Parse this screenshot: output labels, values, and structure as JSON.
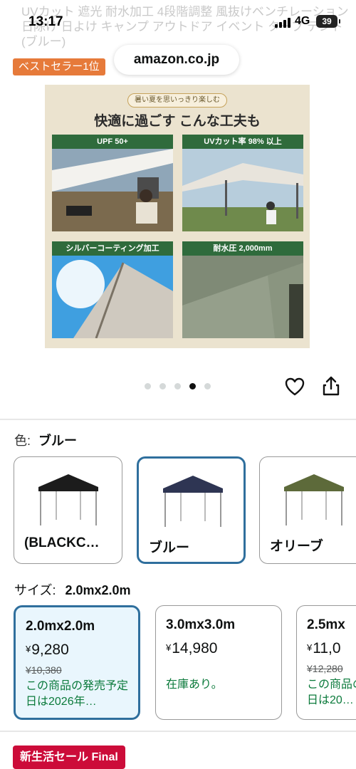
{
  "status_bar": {
    "time": "13:17",
    "network": "4G",
    "battery": "39"
  },
  "browser": {
    "url": "amazon.co.jp"
  },
  "product_title": "UVカット 遮光 耐水加工 4段階調整 風抜けベンチレーション 日除け 日よけ キャンプ アウトドア イベント タープ テント (ブルー)",
  "badge": {
    "bestseller": "ベストセラー1位"
  },
  "hero": {
    "banner": "暑い夏を思いっきり楽しむ",
    "headline": "快適に過ごす こんな工夫も",
    "panels": [
      {
        "label": "UPF 50+"
      },
      {
        "label": "UVカット率 98% 以上"
      },
      {
        "label": "シルバーコーティング加工"
      },
      {
        "label": "耐水圧 2,000mm"
      }
    ]
  },
  "carousel": {
    "total": 5,
    "active": 4
  },
  "color": {
    "label": "色:",
    "selected": "ブルー",
    "options": [
      {
        "label": "(BLACKC…",
        "canopy": "#1c1c1c"
      },
      {
        "label": "ブルー",
        "canopy": "#2e3553"
      },
      {
        "label": "オリーブ",
        "canopy": "#5d6a3a"
      }
    ]
  },
  "size": {
    "label": "サイズ:",
    "selected": "2.0mx2.0m",
    "options": [
      {
        "size": "2.0mx2.0m",
        "price": "9,280",
        "old_price": "¥10,380",
        "stock": "この商品の発売予定日は2026年…"
      },
      {
        "size": "3.0mx3.0m",
        "price": "14,980",
        "old_price": "",
        "stock": "在庫あり。"
      },
      {
        "size": "2.5mx",
        "price": "11,0",
        "old_price": "¥12,280",
        "stock": "この商品の発売予定日は20…"
      }
    ]
  },
  "currency_symbol": "¥",
  "sale_badge": "新生活セール Final",
  "colors": {
    "accent": "#2f6f9d",
    "deal_red": "#cc0c39",
    "stock_green": "#0b7a3b",
    "bestseller": "#e67a3a"
  }
}
